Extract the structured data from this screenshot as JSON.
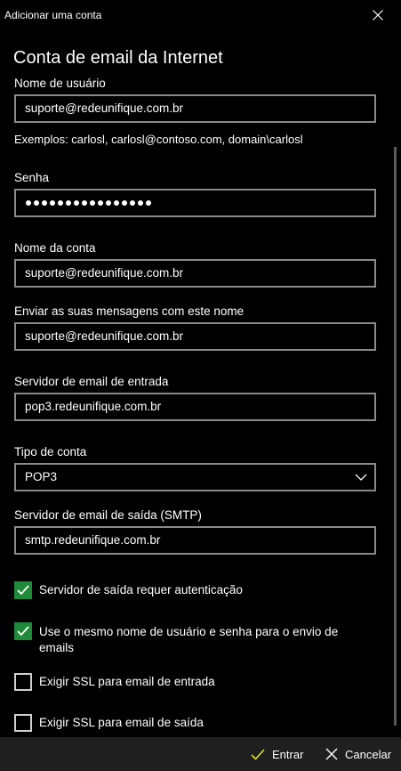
{
  "window": {
    "title": "Adicionar uma conta",
    "close_icon": "close-icon"
  },
  "heading": "Conta de email da Internet",
  "fields": {
    "username": {
      "label": "Nome de usuário",
      "value": "suporte@redeunifique.com.br",
      "hint": "Exemplos: carlosl, carlosl@contoso.com, domain\\carlosl"
    },
    "password": {
      "label": "Senha",
      "masked_length": 16
    },
    "account_name": {
      "label": "Nome da conta",
      "value": "suporte@redeunifique.com.br"
    },
    "sender_name": {
      "label": "Enviar as suas mensagens com este nome",
      "value": "suporte@redeunifique.com.br"
    },
    "incoming_server": {
      "label": "Servidor de email de entrada",
      "value": "pop3.redeunifique.com.br"
    },
    "account_type": {
      "label": "Tipo de conta",
      "value": "POP3"
    },
    "outgoing_server": {
      "label": "Servidor de email de saída (SMTP)",
      "value": "smtp.redeunifique.com.br"
    }
  },
  "checkboxes": [
    {
      "label": "Servidor de saída requer autenticação",
      "checked": true
    },
    {
      "label": "Use o mesmo nome de usuário e senha para o envio de emails",
      "checked": true
    },
    {
      "label": "Exigir SSL para email de entrada",
      "checked": false
    },
    {
      "label": "Exigir SSL para email de saída",
      "checked": false
    }
  ],
  "footer": {
    "sign_in_label": "Entrar",
    "cancel_label": "Cancelar"
  },
  "colors": {
    "background": "#000000",
    "footer": "#1f1f1f",
    "checkbox_checked": "#1f8a3a",
    "sign_in_icon": "#e3e31a",
    "input_border": "#8a8a8a"
  }
}
